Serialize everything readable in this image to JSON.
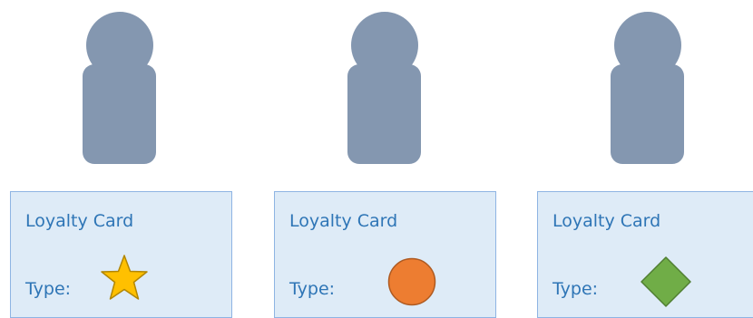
{
  "colors": {
    "person_fill": "#8497b0",
    "card_fill": "#deebf7",
    "card_border": "#8eb4e3",
    "text": "#2e75b6",
    "star_fill": "#ffc000",
    "star_stroke": "#b28600",
    "circle_fill": "#ed7d31",
    "circle_stroke": "#ae5a21",
    "diamond_fill": "#70ad47",
    "diamond_stroke": "#507e32"
  },
  "cards": [
    {
      "title": "Loyalty Card",
      "type_label": "Type:",
      "icon": "star-icon"
    },
    {
      "title": "Loyalty Card",
      "type_label": "Type:",
      "icon": "circle-icon"
    },
    {
      "title": "Loyalty Card",
      "type_label": "Type:",
      "icon": "diamond-icon"
    }
  ]
}
